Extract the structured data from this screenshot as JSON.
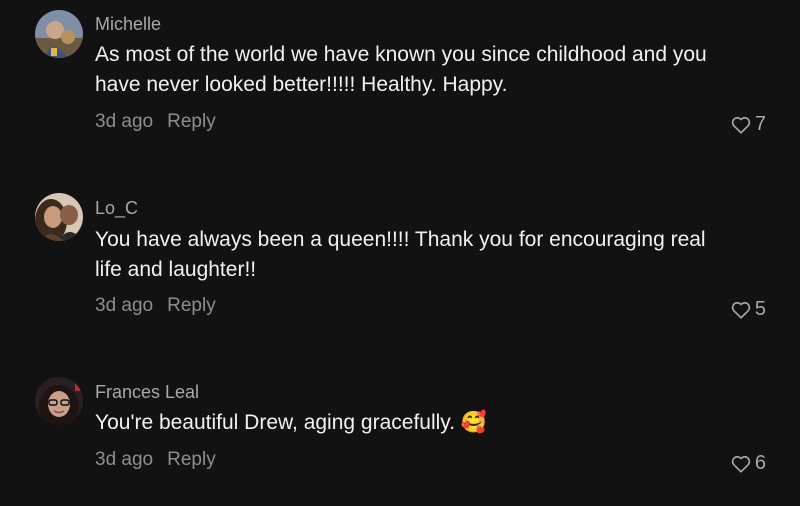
{
  "comments": [
    {
      "username": "Michelle",
      "text": "As most of the world we have known you since childhood and you have never looked better!!!!! Healthy. Happy.",
      "time": "3d ago",
      "reply_label": "Reply",
      "likes": "7"
    },
    {
      "username": "Lo_C",
      "text": "You have always been a queen!!!! Thank you for encouraging real life and laughter!!",
      "time": "3d ago",
      "reply_label": "Reply",
      "likes": "5"
    },
    {
      "username": "Frances Leal",
      "text": "You're beautiful Drew, aging gracefully. 🥰",
      "time": "3d ago",
      "reply_label": "Reply",
      "likes": "6"
    }
  ],
  "icons": {
    "like": "heart-outline-icon"
  },
  "colors": {
    "background": "#121212",
    "text": "#f1f1f1",
    "muted": "#8e8e8e"
  }
}
